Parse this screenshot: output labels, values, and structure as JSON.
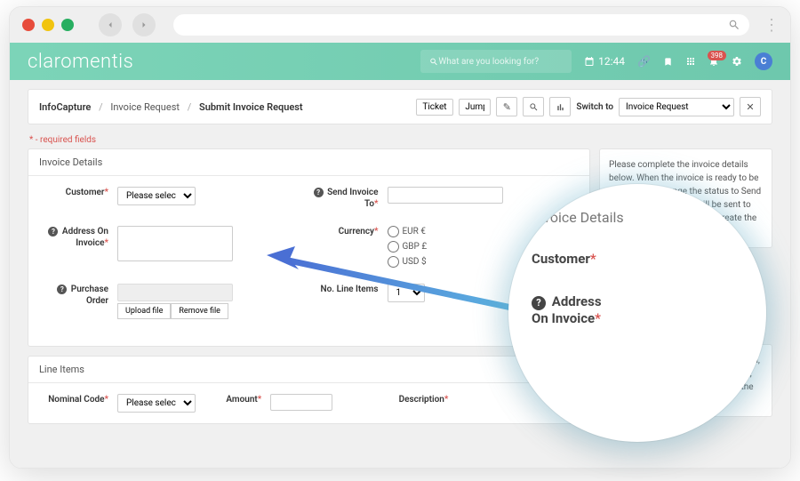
{
  "logo": "claromentis",
  "search_placeholder": "What are you looking for?",
  "clock": "12:44",
  "notification_badge": "398",
  "avatar_letter": "C",
  "breadcrumb": {
    "app": "InfoCapture",
    "l1": "Invoice Request",
    "l2": "Submit Invoice Request"
  },
  "toolbar": {
    "ticket": "Ticket",
    "jump": "Jump",
    "switch": "Switch to",
    "switch_value": "Invoice Request"
  },
  "required_note": "- required fields",
  "panel_invoice": "Invoice Details",
  "panel_line": "Line Items",
  "labels": {
    "customer": "Customer",
    "send_to": "Send Invoice To",
    "address": "Address On Invoice",
    "currency": "Currency",
    "po": "Purchase Order",
    "line_items": "No. Line Items",
    "nominal": "Nominal Code",
    "amount": "Amount",
    "description": "Description"
  },
  "select_placeholder": "Please select...",
  "currency_opts": {
    "eur": "EUR €",
    "gbp": "GBP £",
    "usd": "USD $"
  },
  "line_count": "1",
  "file_upload": "Upload file",
  "file_remove": "Remove file",
  "info1": "Please complete the invoice details below. When the invoice is ready to be sent, please change the status to Send Invoice. A notification will be sent to the Finance Team, who will create the invoice and then set",
  "info2": "Once the invoice has been set to send, a new section will become available, allowing the Finance Team to log the invoice details.",
  "zoom": {
    "title": "Invoice Details",
    "customer": "Customer",
    "address1": "Address",
    "address2": "On Invoice"
  }
}
